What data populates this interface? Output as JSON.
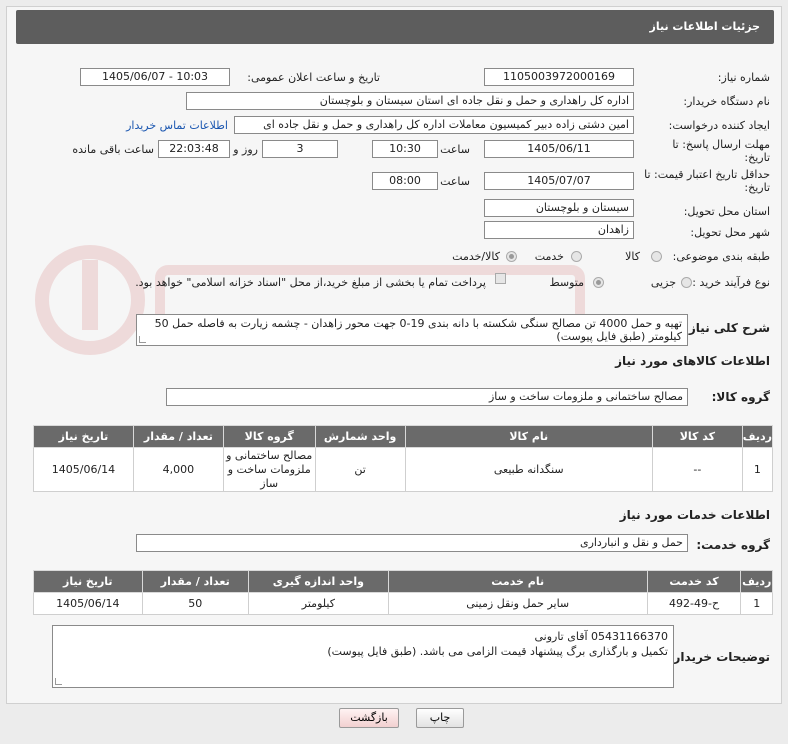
{
  "header": {
    "title": "جزئیات اطلاعات نیاز"
  },
  "fields": {
    "need_number_label": "شماره نیاز:",
    "need_number": "1105003972000169",
    "announce_label": "تاریخ و ساعت اعلان عمومی:",
    "announce_value": "1405/06/07 - 10:03",
    "buyer_org_label": "نام دستگاه خریدار:",
    "buyer_org": "اداره کل راهداری و حمل و نقل جاده ای استان سیستان و بلوچستان",
    "requester_label": "ایجاد کننده درخواست:",
    "requester": "امین دشتی زاده دبیر کمیسیون معاملات اداره کل راهداری و حمل و نقل جاده ای",
    "contact_link": "اطلاعات تماس خریدار",
    "deadline_label": "مهلت ارسال پاسخ: تا تاریخ:",
    "deadline_date": "1405/06/11",
    "time_label": "ساعت",
    "deadline_time": "10:30",
    "days": "3",
    "days_label": "روز و",
    "remaining": "22:03:48",
    "remaining_label": "ساعت باقی مانده",
    "validity_label": "حداقل تاریخ اعتبار قیمت: تا تاریخ:",
    "validity_date": "1405/07/07",
    "validity_time_label": "ساعت",
    "validity_time": "08:00",
    "province_label": "استان محل تحویل:",
    "province": "سیستان و بلوچستان",
    "city_label": "شهر محل تحویل:",
    "city": "زاهدان",
    "category_label": "طبقه بندی موضوعی:",
    "category_options": [
      "کالا",
      "خدمت",
      "کالا/خدمت"
    ],
    "process_label": "نوع فرآیند خرید :",
    "process_options": [
      "جزیی",
      "متوسط"
    ],
    "payment_note": "پرداخت تمام یا بخشی از مبلغ خرید،از محل \"اسناد خزانه اسلامی\" خواهد بود."
  },
  "description": {
    "label": "شرح کلی نیاز:",
    "text": "تهیه و حمل 4000 تن مصالح سنگی شکسته با دانه بندی 19-0 جهت محور زاهدان - چشمه زیارت به فاصله حمل 50 کیلومتر (طبق فایل پیوست)"
  },
  "goods": {
    "section_title": "اطلاعات کالاهای مورد نیاز",
    "group_label": "گروه کالا:",
    "group_value": "مصالح ساختمانی و ملزومات ساخت و ساز",
    "columns": [
      "ردیف",
      "کد کالا",
      "نام کالا",
      "واحد شمارش",
      "گروه کالا",
      "تعداد / مقدار",
      "تاریخ نیاز"
    ],
    "rows": [
      [
        "1",
        "--",
        "سنگدانه طبیعی",
        "تن",
        "مصالح ساختمانی و ملزومات ساخت و ساز",
        "4,000",
        "1405/06/14"
      ]
    ]
  },
  "services": {
    "section_title": "اطلاعات خدمات مورد نیاز",
    "group_label": "گروه خدمت:",
    "group_value": "حمل و نقل و انبارداری",
    "columns": [
      "ردیف",
      "کد خدمت",
      "نام خدمت",
      "واحد اندازه گیری",
      "تعداد / مقدار",
      "تاریخ نیاز"
    ],
    "rows": [
      [
        "1",
        "ح-49-492",
        "سایر حمل ونقل زمینی",
        "کیلومتر",
        "50",
        "1405/06/14"
      ]
    ]
  },
  "buyer_notes": {
    "label": "توضیحات خریدار:",
    "line1": "05431166370 آقای تارونی",
    "line2": "تکمیل و بارگذاری برگ پیشنهاد قیمت الزامی می باشد. (طبق فایل پیوست)"
  },
  "buttons": {
    "print": "چاپ",
    "back": "بازگشت"
  }
}
